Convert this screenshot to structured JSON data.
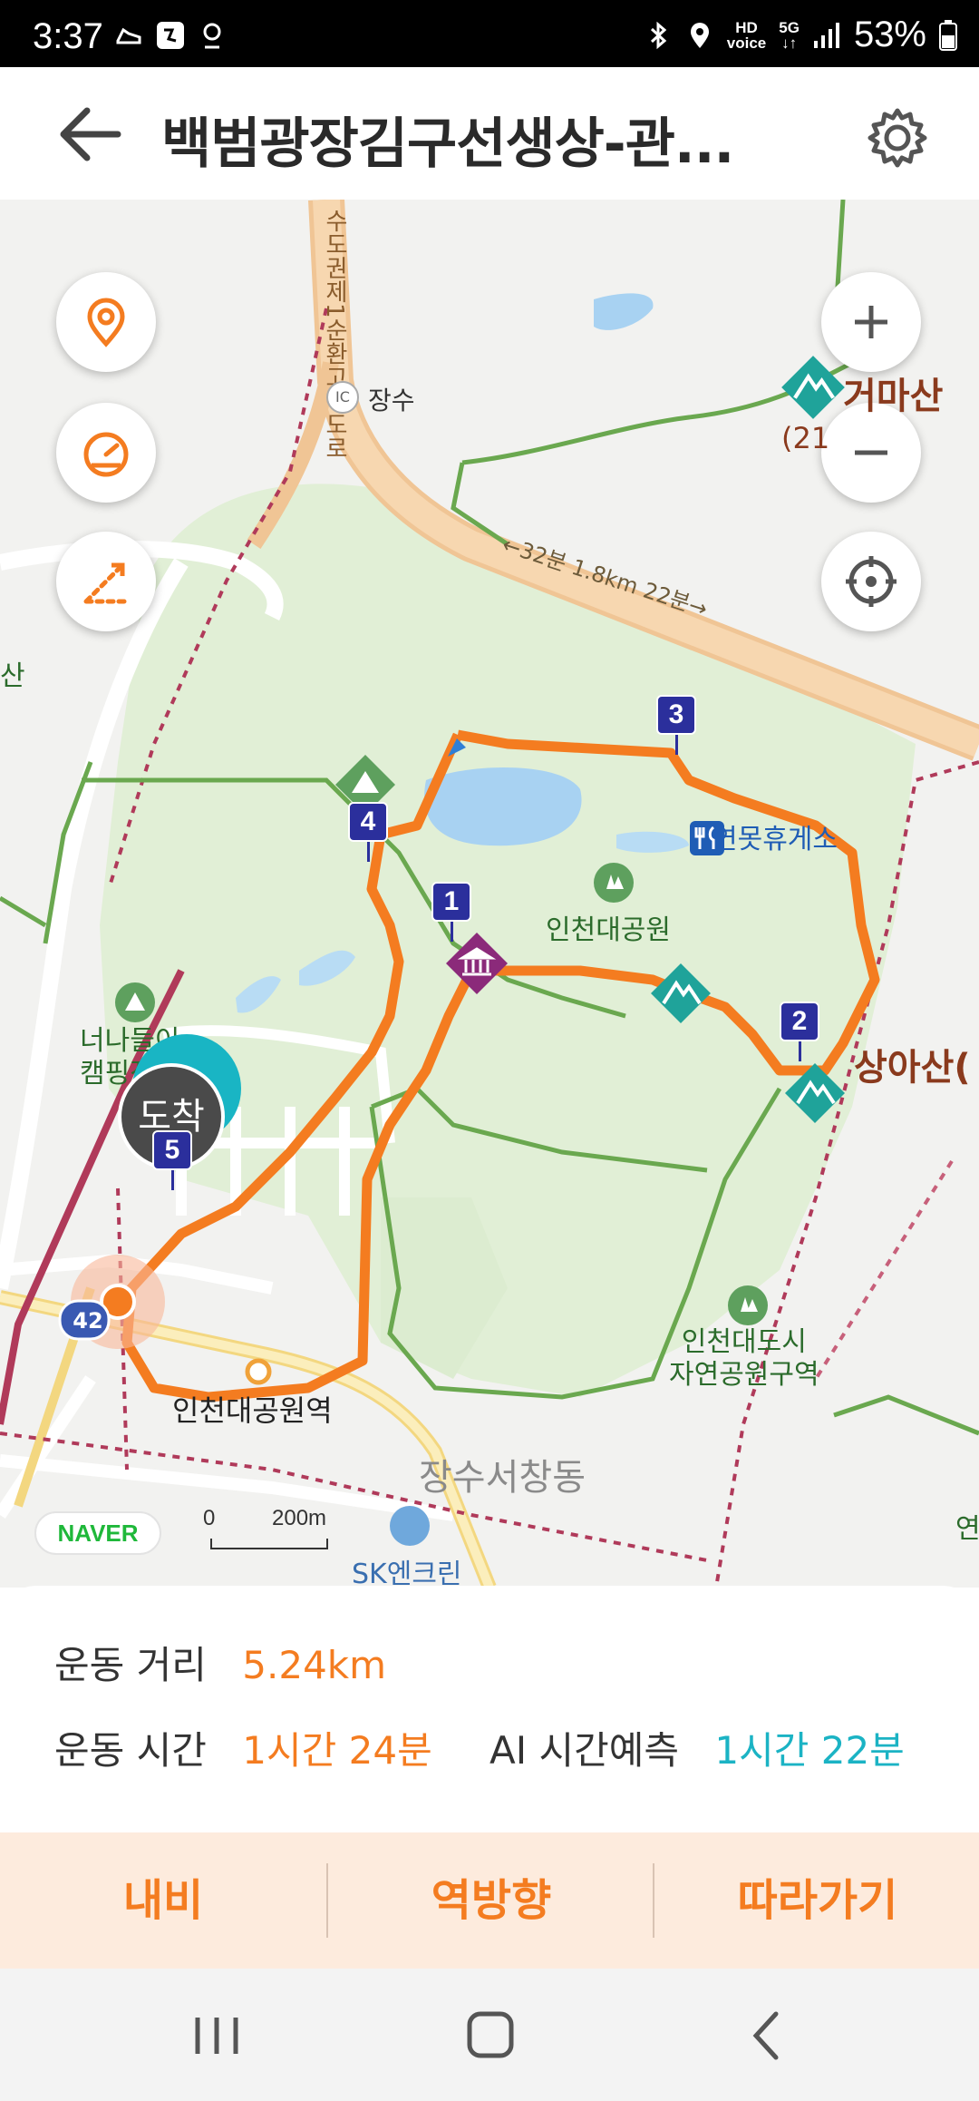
{
  "status_bar": {
    "time": "3:37",
    "battery": "53%",
    "network": "5G",
    "voice": "HD"
  },
  "header": {
    "title": "백범광장김구선생상-관...",
    "back_icon": "arrow-left-icon",
    "settings_icon": "gear-icon"
  },
  "map": {
    "labels": {
      "highway": "수도권제1순환고속도로",
      "ic_name": "장수",
      "ic_badge": "IC",
      "trail_time": "←32분 1.8km 22분→",
      "restaurant": "연못휴게소",
      "park": "인천대공원",
      "mountain1": "거마산",
      "mountain1_elev": "(21",
      "mountain2": "상아산(",
      "campground": "너나들이\n캠핑장",
      "nature_park": "인천대도시\n자연공원구역",
      "station": "인천대공원역",
      "district": "장수서창동",
      "gas_station": "SK엔크린",
      "road_number": "42",
      "edge_left": "산",
      "edge_right": "연"
    },
    "waypoints": [
      "1",
      "2",
      "3",
      "4",
      "5"
    ],
    "arrival_label": "도착",
    "naver_logo": "NAVER",
    "scale_zero": "0",
    "scale_max": "200m",
    "route_color": "#f47c20"
  },
  "stats": {
    "distance_label": "운동 거리",
    "distance_value": "5.24km",
    "time_label": "운동 시간",
    "time_value": "1시간 24분",
    "ai_label": "AI 시간예측",
    "ai_value": "1시간 22분"
  },
  "actions": {
    "navi": "내비",
    "reverse": "역방향",
    "follow": "따라가기"
  }
}
